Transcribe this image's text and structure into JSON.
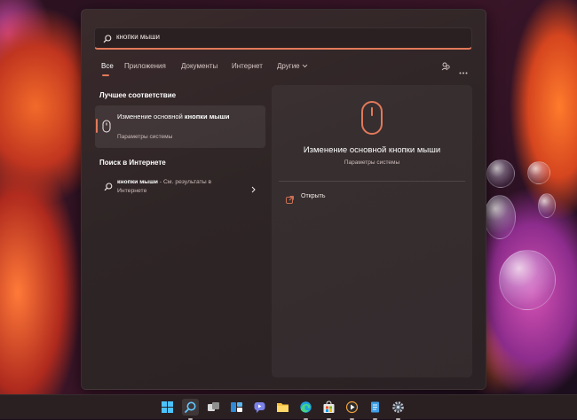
{
  "search": {
    "query": "кнопки мыши"
  },
  "tabs": [
    {
      "label": "Все",
      "active": true
    },
    {
      "label": "Приложения"
    },
    {
      "label": "Документы"
    },
    {
      "label": "Интернет"
    },
    {
      "label": "Другие"
    }
  ],
  "sections": {
    "best_match": "Лучшее соответствие",
    "web_search": "Поиск в Интернете"
  },
  "best_match": {
    "title_normal": "Изменение основной ",
    "title_bold": "кнопки мыши",
    "subtitle": "Параметры системы",
    "icon": "mouse-icon"
  },
  "web_result": {
    "query": "кнопки мыши",
    "suffix": " - См. результаты в Интернете",
    "icon": "search-icon"
  },
  "preview": {
    "title": "Изменение основной кнопки мыши",
    "subtitle": "Параметры системы",
    "icon": "mouse-icon",
    "actions": [
      {
        "label": "Открыть",
        "icon": "open-external-icon"
      }
    ]
  },
  "taskbar": {
    "items": [
      {
        "name": "start",
        "icon": "windows-logo-icon"
      },
      {
        "name": "search",
        "icon": "search-icon",
        "active": true
      },
      {
        "name": "task-view",
        "icon": "task-view-icon"
      },
      {
        "name": "widgets",
        "icon": "widgets-icon"
      },
      {
        "name": "chat",
        "icon": "teams-chat-icon"
      },
      {
        "name": "file-explorer",
        "icon": "folder-icon"
      },
      {
        "name": "edge",
        "icon": "edge-browser-icon"
      },
      {
        "name": "store",
        "icon": "store-icon"
      },
      {
        "name": "media-player",
        "icon": "media-player-icon"
      },
      {
        "name": "notepad",
        "icon": "notepad-icon"
      },
      {
        "name": "settings",
        "icon": "gear-icon"
      }
    ]
  },
  "colors": {
    "accent": "#e2795a",
    "panel": "#2e2526",
    "taskbar": "#2a2022"
  }
}
